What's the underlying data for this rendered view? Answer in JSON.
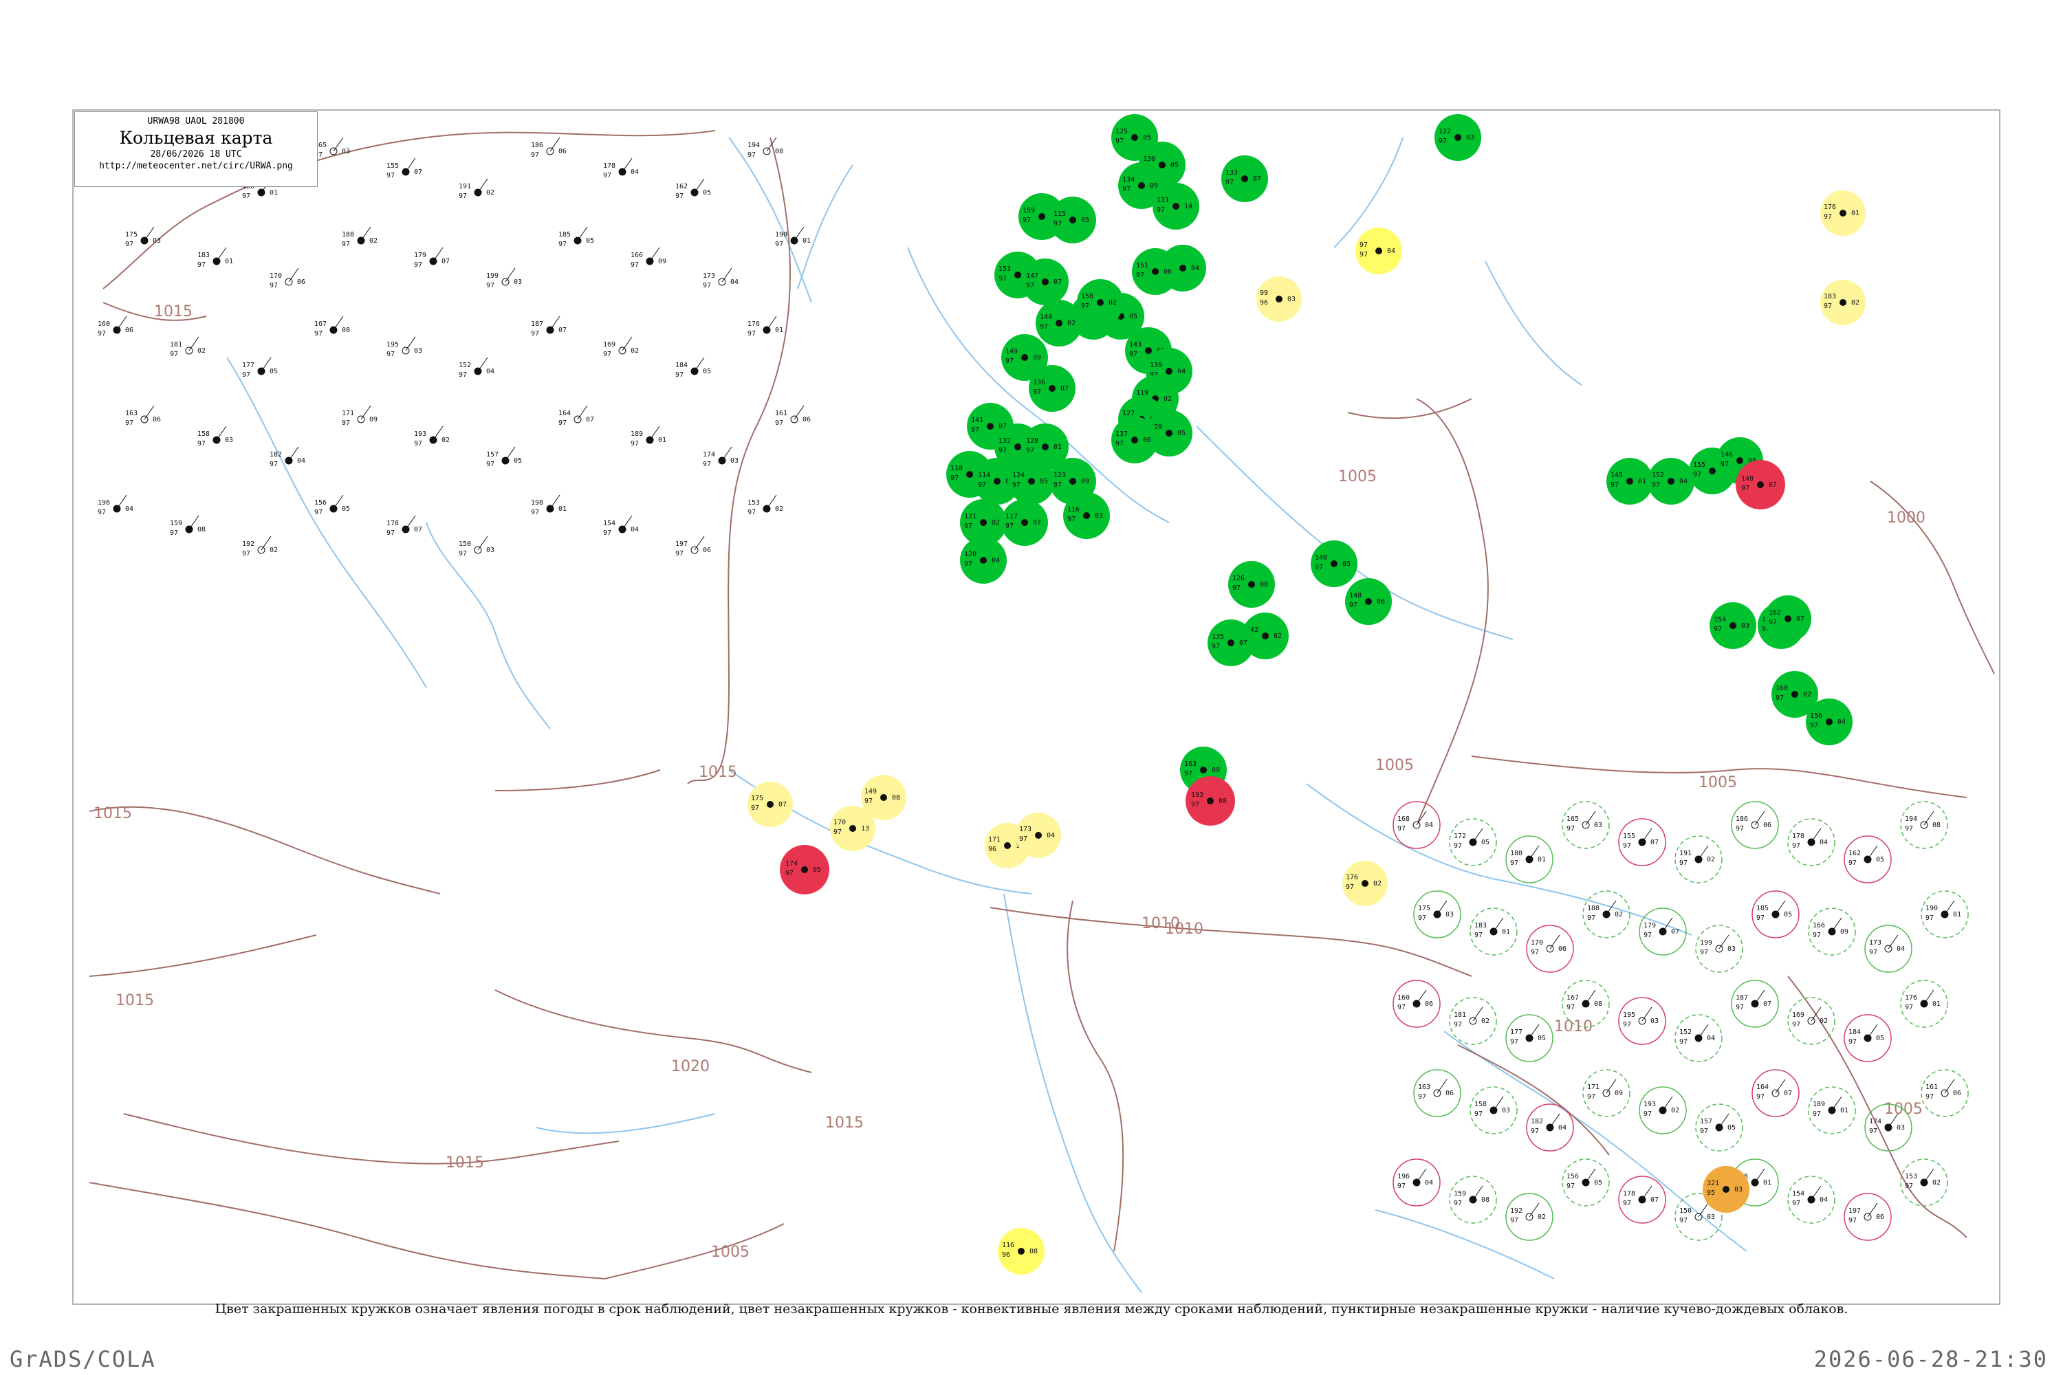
{
  "header": {
    "code": "URWA98 UAOL 281800",
    "title": "Кольцевая карта",
    "datetime": "28/06/2026 18 UTC",
    "url": "http://meteocenter.net/circ/URWA.png"
  },
  "caption": "Цвет закрашенных кружков означает явления погоды в срок наблюдений, цвет незакрашенных кружков - конвективные явления между сроками наблюдений, пунктирные незакрашенные кружки - наличие кучево-дождевых облаков.",
  "footer": {
    "left": "GrADS/COLA",
    "right": "2026-06-28-21:30"
  },
  "colors": {
    "river": "#8ec5ee",
    "isobar": "#a06e66",
    "green": "#00c22e",
    "red": "#e8354f",
    "yellow": "#fffd66",
    "paleyellow": "#fff59a",
    "orange": "#f0a93c",
    "ring_green": "#55bb55",
    "ring_red": "#d43f6a",
    "frame": "#888888"
  },
  "isobars": [
    "1015",
    "1015",
    "1015",
    "1015",
    "1020",
    "1015",
    "1015",
    "1010",
    "1005",
    "1010",
    "1005",
    "1005",
    "1005",
    "1000",
    "1005",
    "1010"
  ],
  "filled_stations": {
    "green": [
      [
        "125",
        "97",
        "05"
      ],
      [
        "130",
        "97",
        "05"
      ],
      [
        "134",
        "97",
        "09"
      ],
      [
        "131",
        "97",
        "14"
      ],
      [
        "138",
        "97",
        "04"
      ],
      [
        "151",
        "97",
        "06"
      ],
      [
        "133",
        "97",
        "07"
      ],
      [
        "159",
        "97",
        "03"
      ],
      [
        "115",
        "97",
        "05"
      ],
      [
        "153",
        "97",
        "03"
      ],
      [
        "147",
        "97",
        "07"
      ],
      [
        "150",
        "97",
        "04"
      ],
      [
        "161",
        "97",
        "05"
      ],
      [
        "144",
        "97",
        "02"
      ],
      [
        "149",
        "97",
        "09"
      ],
      [
        "136",
        "97",
        "07"
      ],
      [
        "158",
        "97",
        "02"
      ],
      [
        "143",
        "97",
        "05"
      ],
      [
        "139",
        "97",
        "04"
      ],
      [
        "119",
        "97",
        "02"
      ],
      [
        "127",
        "97",
        "08"
      ],
      [
        "129",
        "97",
        "05"
      ],
      [
        "137",
        "97",
        "06"
      ],
      [
        "141",
        "97",
        "07"
      ],
      [
        "132",
        "97",
        "03"
      ],
      [
        "128",
        "97",
        "01"
      ],
      [
        "118",
        "97",
        "04"
      ],
      [
        "114",
        "97",
        "06"
      ],
      [
        "124",
        "97",
        "05"
      ],
      [
        "123",
        "97",
        "09"
      ],
      [
        "116",
        "97",
        "03"
      ],
      [
        "121",
        "97",
        "02"
      ],
      [
        "117",
        "97",
        "07"
      ],
      [
        "120",
        "97",
        "04"
      ],
      [
        "126",
        "97",
        "08"
      ],
      [
        "140",
        "97",
        "05"
      ],
      [
        "148",
        "97",
        "06"
      ],
      [
        "142",
        "97",
        "02"
      ],
      [
        "135",
        "97",
        "07"
      ],
      [
        "122",
        "97",
        "03"
      ],
      [
        "145",
        "97",
        "01"
      ],
      [
        "152",
        "97",
        "04"
      ],
      [
        "155",
        "97",
        "06"
      ],
      [
        "146",
        "97",
        "08"
      ],
      [
        "154",
        "97",
        "03"
      ],
      [
        "157",
        "97",
        "05"
      ],
      [
        "162",
        "97",
        "07"
      ],
      [
        "160",
        "97",
        "02"
      ],
      [
        "156",
        "97",
        "04"
      ],
      [
        "163",
        "97",
        "09"
      ]
    ],
    "red": [
      [
        "174",
        "97",
        "05"
      ],
      [
        "148",
        "97",
        "07"
      ],
      [
        "193",
        "97",
        "08"
      ]
    ],
    "yellow": [
      [
        "97",
        "97",
        "04"
      ],
      [
        "116",
        "96",
        "08"
      ]
    ],
    "paleyellow": [
      [
        "175",
        "97",
        "07"
      ],
      [
        "149",
        "97",
        "08"
      ],
      [
        "170",
        "97",
        "13"
      ],
      [
        "171",
        "96",
        "14"
      ],
      [
        "173",
        "97",
        "04"
      ],
      [
        "99",
        "96",
        "03"
      ],
      [
        "176",
        "97",
        "02"
      ],
      [
        "176",
        "97",
        "01"
      ],
      [
        "183",
        "97",
        "02"
      ]
    ],
    "orange": [
      [
        "321",
        "95",
        "03"
      ]
    ]
  },
  "plain_stations": [
    [
      "168",
      "97",
      "04"
    ],
    [
      "172",
      "97",
      "05"
    ],
    [
      "180",
      "97",
      "01"
    ],
    [
      "165",
      "97",
      "03"
    ],
    [
      "155",
      "97",
      "07"
    ],
    [
      "191",
      "97",
      "02"
    ],
    [
      "186",
      "97",
      "06"
    ],
    [
      "178",
      "97",
      "04"
    ],
    [
      "162",
      "97",
      "05"
    ],
    [
      "194",
      "97",
      "08"
    ],
    [
      "175",
      "97",
      "03"
    ],
    [
      "183",
      "97",
      "01"
    ],
    [
      "170",
      "97",
      "06"
    ],
    [
      "188",
      "97",
      "02"
    ],
    [
      "179",
      "97",
      "07"
    ],
    [
      "199",
      "97",
      "03"
    ],
    [
      "185",
      "97",
      "05"
    ],
    [
      "166",
      "97",
      "09"
    ],
    [
      "173",
      "97",
      "04"
    ],
    [
      "190",
      "97",
      "01"
    ],
    [
      "160",
      "97",
      "06"
    ],
    [
      "181",
      "97",
      "02"
    ],
    [
      "177",
      "97",
      "05"
    ],
    [
      "167",
      "97",
      "08"
    ],
    [
      "195",
      "97",
      "03"
    ],
    [
      "152",
      "97",
      "04"
    ],
    [
      "187",
      "97",
      "07"
    ],
    [
      "169",
      "97",
      "02"
    ],
    [
      "184",
      "97",
      "05"
    ],
    [
      "176",
      "97",
      "01"
    ],
    [
      "163",
      "97",
      "06"
    ],
    [
      "158",
      "97",
      "03"
    ],
    [
      "182",
      "97",
      "04"
    ],
    [
      "171",
      "97",
      "09"
    ],
    [
      "193",
      "97",
      "02"
    ],
    [
      "157",
      "97",
      "05"
    ],
    [
      "164",
      "97",
      "07"
    ],
    [
      "189",
      "97",
      "01"
    ],
    [
      "174",
      "97",
      "03"
    ],
    [
      "161",
      "97",
      "06"
    ],
    [
      "196",
      "97",
      "04"
    ],
    [
      "159",
      "97",
      "08"
    ],
    [
      "192",
      "97",
      "02"
    ],
    [
      "156",
      "97",
      "05"
    ],
    [
      "178",
      "97",
      "07"
    ],
    [
      "150",
      "97",
      "03"
    ],
    [
      "198",
      "97",
      "01"
    ],
    [
      "154",
      "97",
      "04"
    ],
    [
      "197",
      "97",
      "06"
    ],
    [
      "153",
      "97",
      "02"
    ]
  ]
}
